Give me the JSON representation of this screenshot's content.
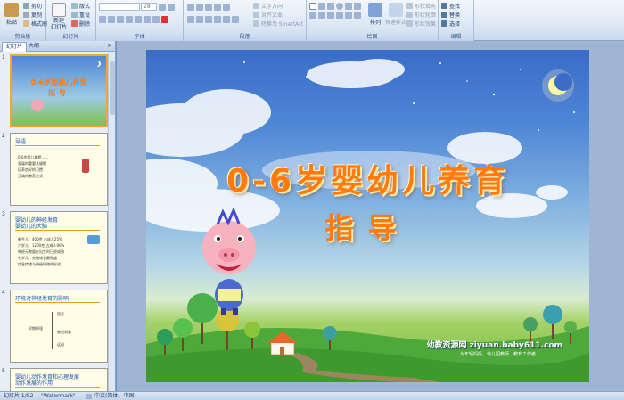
{
  "ribbon": {
    "clipboard": {
      "paste": "粘贴",
      "cut": "剪切",
      "copy": "复制",
      "format_painter": "格式刷",
      "label": "剪贴板"
    },
    "slides": {
      "new_slide": "新建\n幻灯片",
      "layout": "版式",
      "reset": "重设",
      "delete": "删除",
      "label": "幻灯片"
    },
    "font": {
      "font_size": "28",
      "label": "字体"
    },
    "paragraph": {
      "text_direction": "文字方向",
      "align_text": "对齐文本",
      "smartart": "转换为 SmartArt",
      "label": "段落"
    },
    "drawing": {
      "arrange": "排列",
      "quick_styles": "快速样式",
      "shape_fill": "形状填充",
      "shape_outline": "形状轮廓",
      "shape_effects": "形状效果",
      "label": "绘图"
    },
    "editing": {
      "find": "查找",
      "replace": "替换",
      "select": "选择",
      "label": "编辑"
    }
  },
  "pane": {
    "tab_slides": "幻灯片",
    "tab_outline": "大纲",
    "close": "×"
  },
  "thumbnails": [
    {
      "num": "1",
      "title": "0-6岁婴幼儿养育",
      "subtitle": "指导"
    },
    {
      "num": "2",
      "title": "导语",
      "bullets": [
        "0-6岁婴儿期是……",
        "发展的重要关键期",
        "培养良好的习惯",
        "正确的教养方式"
      ]
    },
    {
      "num": "3",
      "title": "婴幼儿的神经发育",
      "title2": "婴幼儿的大脑",
      "bullets": [
        "新生儿：400克 占成人25%",
        "六岁儿：1200克 占成人90%",
        "神经元数量在出生时已经成熟",
        "七岁儿：突触增长最旺盛",
        "信息传递与神经网络的形成"
      ]
    },
    {
      "num": "4",
      "title": "环境对神经发育的影响",
      "bullets": [
        "早期环境",
        "营养",
        "感觉刺激",
        "运动"
      ]
    },
    {
      "num": "5",
      "title": "婴幼儿动作发育和心理发展",
      "title2": "动作发展的作用"
    }
  ],
  "slide": {
    "title_line1": "0-6岁婴幼儿养育",
    "title_line2": "指导",
    "brand": "幼教资源网 ziyuan.baby611.com",
    "brand_sub": "为年轻妈妈、幼儿园教师、教育工作者……"
  },
  "status": {
    "slide_count": "幻灯片 1/52",
    "theme": "\"Watermark\"",
    "language": "中文(简体，中国)"
  },
  "colors": {
    "title_orange": "#ff7a12",
    "ribbon_blue": "#dbe6f4",
    "selection_orange": "#f0a431"
  }
}
